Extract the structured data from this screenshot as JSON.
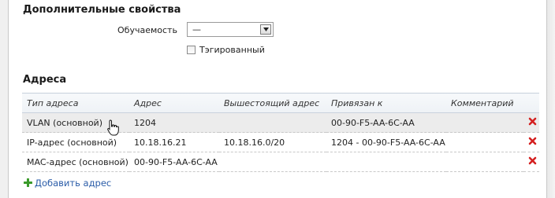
{
  "extra": {
    "title": "Дополнительные свойства",
    "learnability_label": "Обучаемость",
    "learnability_value": "—",
    "tagged_label": "Тэгированный"
  },
  "addresses": {
    "title": "Адреса",
    "columns": [
      "Тип адреса",
      "Адрес",
      "Вышестоящий адрес",
      "Привязан к",
      "Комментарий"
    ],
    "rows": [
      {
        "type": "VLAN (основной)",
        "address": "1204",
        "parent": "",
        "bound": "00-90-F5-AA-6C-AA",
        "comment": ""
      },
      {
        "type": "IP-адрес (основной)",
        "address": "10.18.16.21",
        "parent": "10.18.16.0/20",
        "bound": "1204 - 00-90-F5-AA-6C-AA",
        "comment": ""
      },
      {
        "type": "MAC-адрес (основной)",
        "address": "00-90-F5-AA-6C-AA",
        "parent": "",
        "bound": "",
        "comment": ""
      }
    ],
    "add_label": "Добавить адрес"
  },
  "colors": {
    "delete": "#d42020",
    "add": "#3a9a2a",
    "link": "#2a5ca8"
  }
}
